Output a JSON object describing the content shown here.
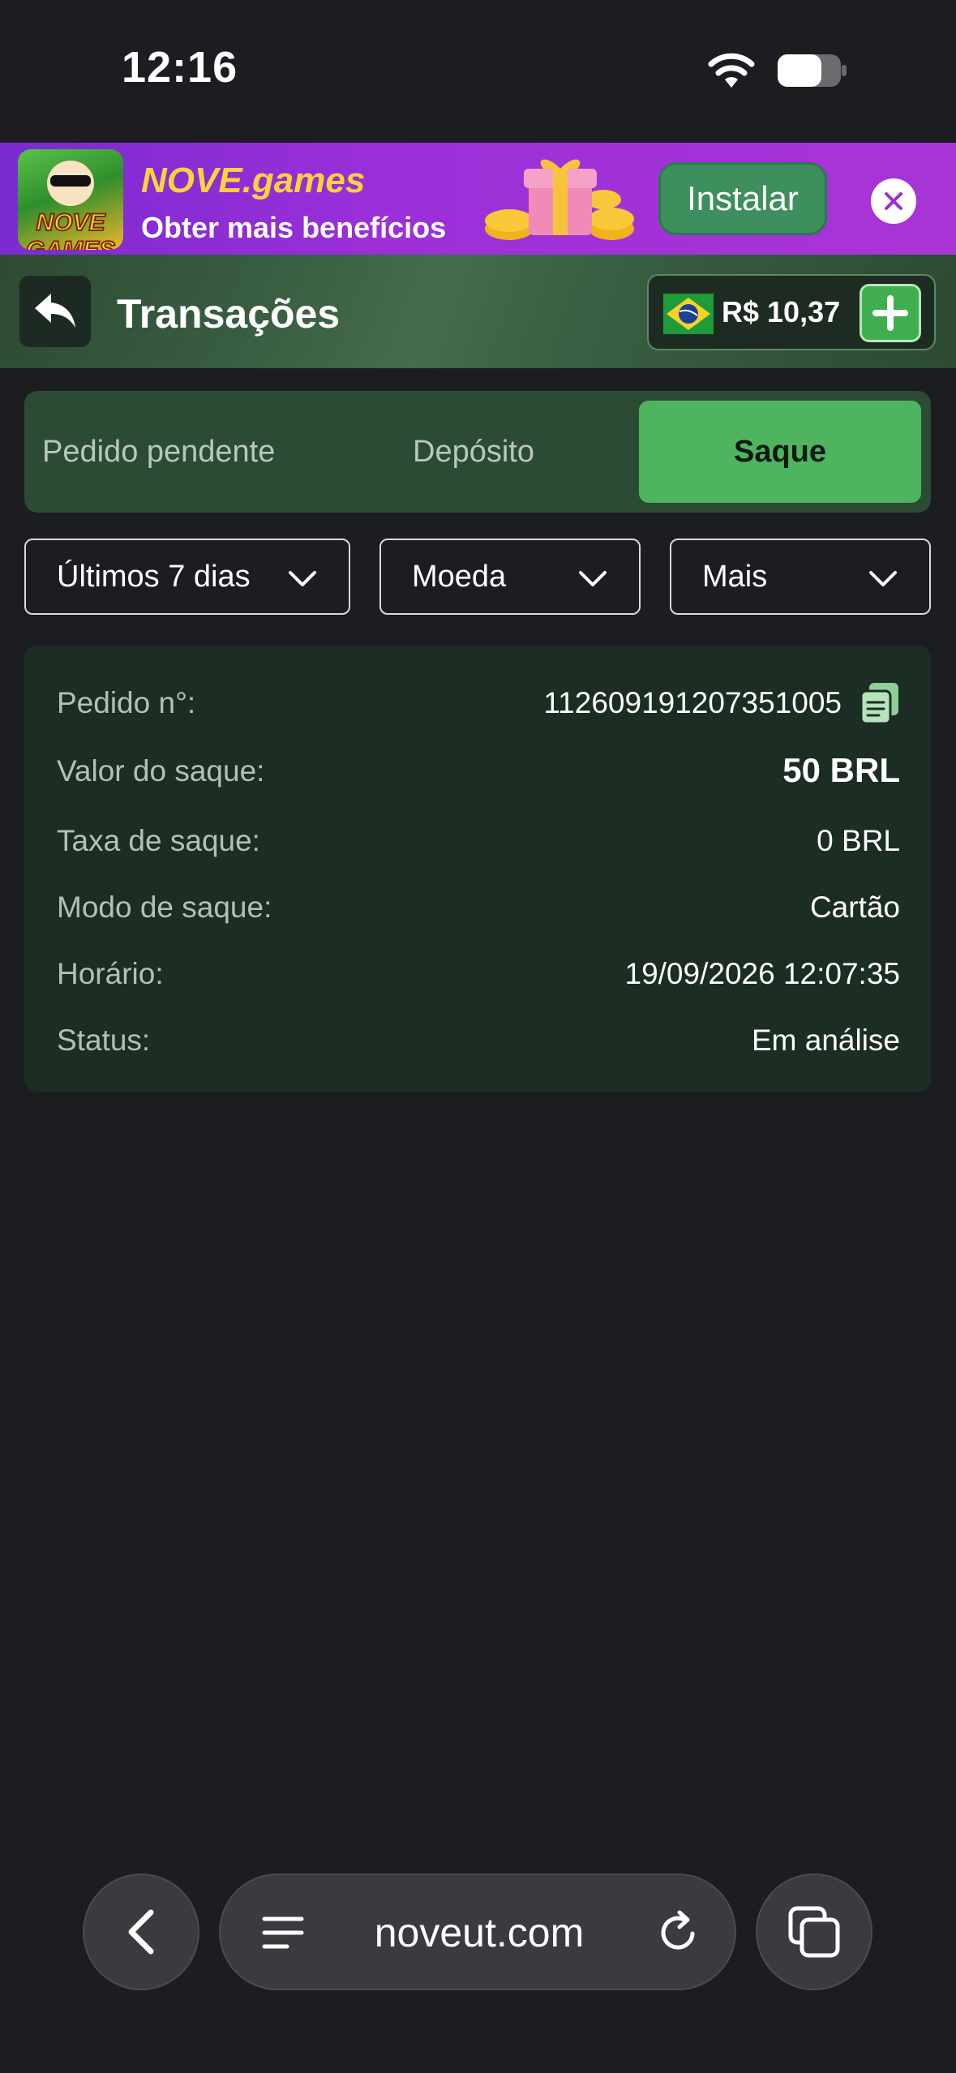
{
  "status_bar": {
    "time": "12:16",
    "wifi_icon": "wifi-icon",
    "battery_icon": "battery-icon"
  },
  "banner": {
    "logo_text": "NOVE GAMES",
    "title": "NOVE.games",
    "subtitle": "Obter mais benefícios",
    "install_label": "Instalar",
    "close_icon": "close-icon",
    "colors": {
      "bg": "#9b2fd8",
      "title": "#ffd23d",
      "install": "#3d8f5d"
    }
  },
  "header": {
    "title": "Transações",
    "back_icon": "back-arrow-icon",
    "balance": "R$ 10,37",
    "flag_icon": "brazil-flag-icon",
    "add_icon": "plus-icon"
  },
  "tabs": [
    {
      "label": "Pedido pendente",
      "active": false
    },
    {
      "label": "Depósito",
      "active": false
    },
    {
      "label": "Saque",
      "active": true
    }
  ],
  "filters": {
    "period": "Últimos 7 dias",
    "currency": "Moeda",
    "more": "Mais"
  },
  "transaction": {
    "order_label": "Pedido n°:",
    "order_value": "112609191207351005",
    "amount_label": "Valor do saque:",
    "amount_value": "50 BRL",
    "fee_label": "Taxa de saque:",
    "fee_value": "0 BRL",
    "mode_label": "Modo de saque:",
    "mode_value": "Cartão",
    "time_label": "Horário:",
    "time_value": "19/09/2026 12:07:35",
    "status_label": "Status:",
    "status_value": "Em análise"
  },
  "browser": {
    "url": "noveut.com",
    "back_icon": "chevron-left-icon",
    "menu_icon": "menu-lines-icon",
    "reload_icon": "reload-icon",
    "tabs_icon": "tabs-icon"
  }
}
